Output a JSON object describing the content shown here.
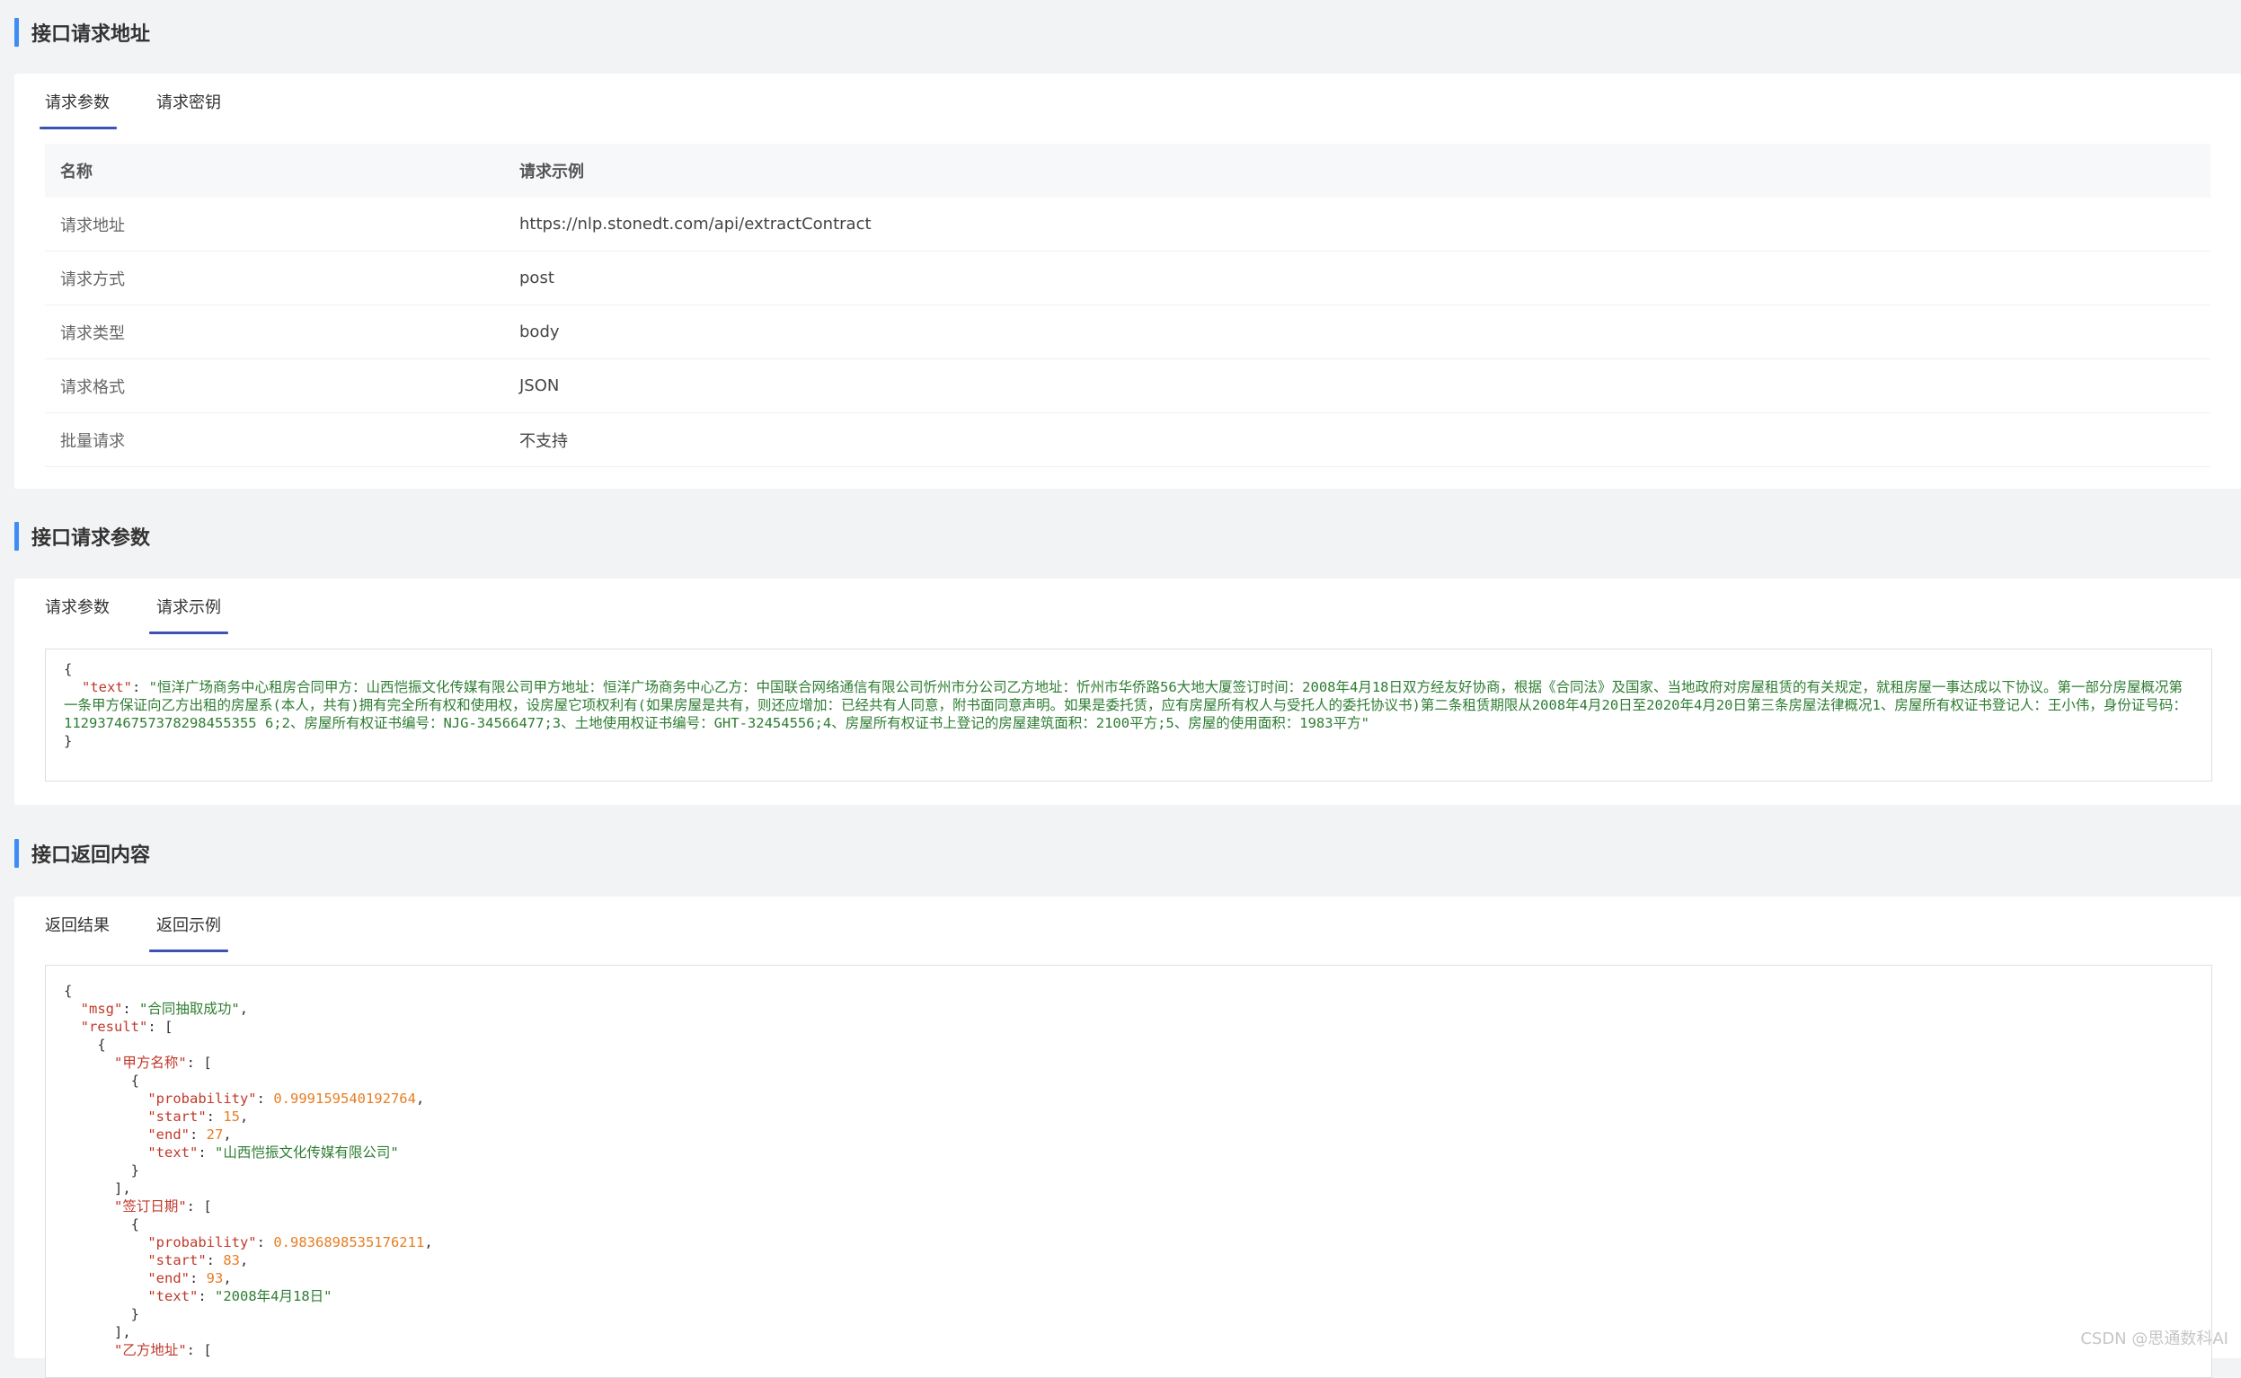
{
  "sections": {
    "request_address": {
      "title": "接口请求地址",
      "tabs": [
        "请求参数",
        "请求密钥"
      ],
      "table": {
        "headers": [
          "名称",
          "请求示例"
        ],
        "rows": [
          [
            "请求地址",
            "https://nlp.stonedt.com/api/extractContract"
          ],
          [
            "请求方式",
            "post"
          ],
          [
            "请求类型",
            "body"
          ],
          [
            "请求格式",
            "JSON"
          ],
          [
            "批量请求",
            "不支持"
          ]
        ]
      }
    },
    "request_params": {
      "title": "接口请求参数",
      "tabs": [
        "请求参数",
        "请求示例"
      ],
      "code": {
        "open": "{",
        "key": "\"text\"",
        "value": "\"恒洋广场商务中心租房合同甲方：山西恺振文化传媒有限公司甲方地址：恒洋广场商务中心乙方：中国联合网络通信有限公司忻州市分公司乙方地址：忻州市华侨路56大地大厦签订时间：2008年4月18日双方经友好协商，根据《合同法》及国家、当地政府对房屋租赁的有关规定，就租房屋一事达成以下协议。第一部分房屋概况第一条甲方保证向乙方出租的房屋系(本人，共有)拥有完全所有权和使用权，设房屋它项权利有(如果房屋是共有，则还应增加：已经共有人同意，附书面同意声明。如果是委托赁，应有房屋所有权人与受托人的委托协议书)第二条租赁期限从2008年4月20日至2020年4月20日第三条房屋法律概况1、房屋所有权证书登记人：王小伟，身份证号码：11293746757378298455355 6;2、房屋所有权证书编号：NJG-34566477;3、土地使用权证书编号：GHT-32454556;4、房屋所有权证书上登记的房屋建筑面积：2100平方;5、房屋的使用面积：1983平方\"",
        "close": "}"
      }
    },
    "response": {
      "title": "接口返回内容",
      "tabs": [
        "返回结果",
        "返回示例"
      ],
      "code": {
        "msg_key": "\"msg\"",
        "msg_val": "\"合同抽取成功\"",
        "result_key": "\"result\"",
        "groups": [
          {
            "key": "\"甲方名称\"",
            "probability": "0.999159540192764",
            "start": "15",
            "end": "27",
            "text": "\"山西恺振文化传媒有限公司\""
          },
          {
            "key": "\"签订日期\"",
            "probability": "0.9836898535176211",
            "start": "83",
            "end": "93",
            "text": "\"2008年4月18日\""
          }
        ],
        "next_key": "\"乙方地址\""
      }
    }
  },
  "labels": {
    "probability": "\"probability\"",
    "start": "\"start\"",
    "end": "\"end\"",
    "text": "\"text\""
  },
  "watermark": "CSDN @思通数科AI"
}
